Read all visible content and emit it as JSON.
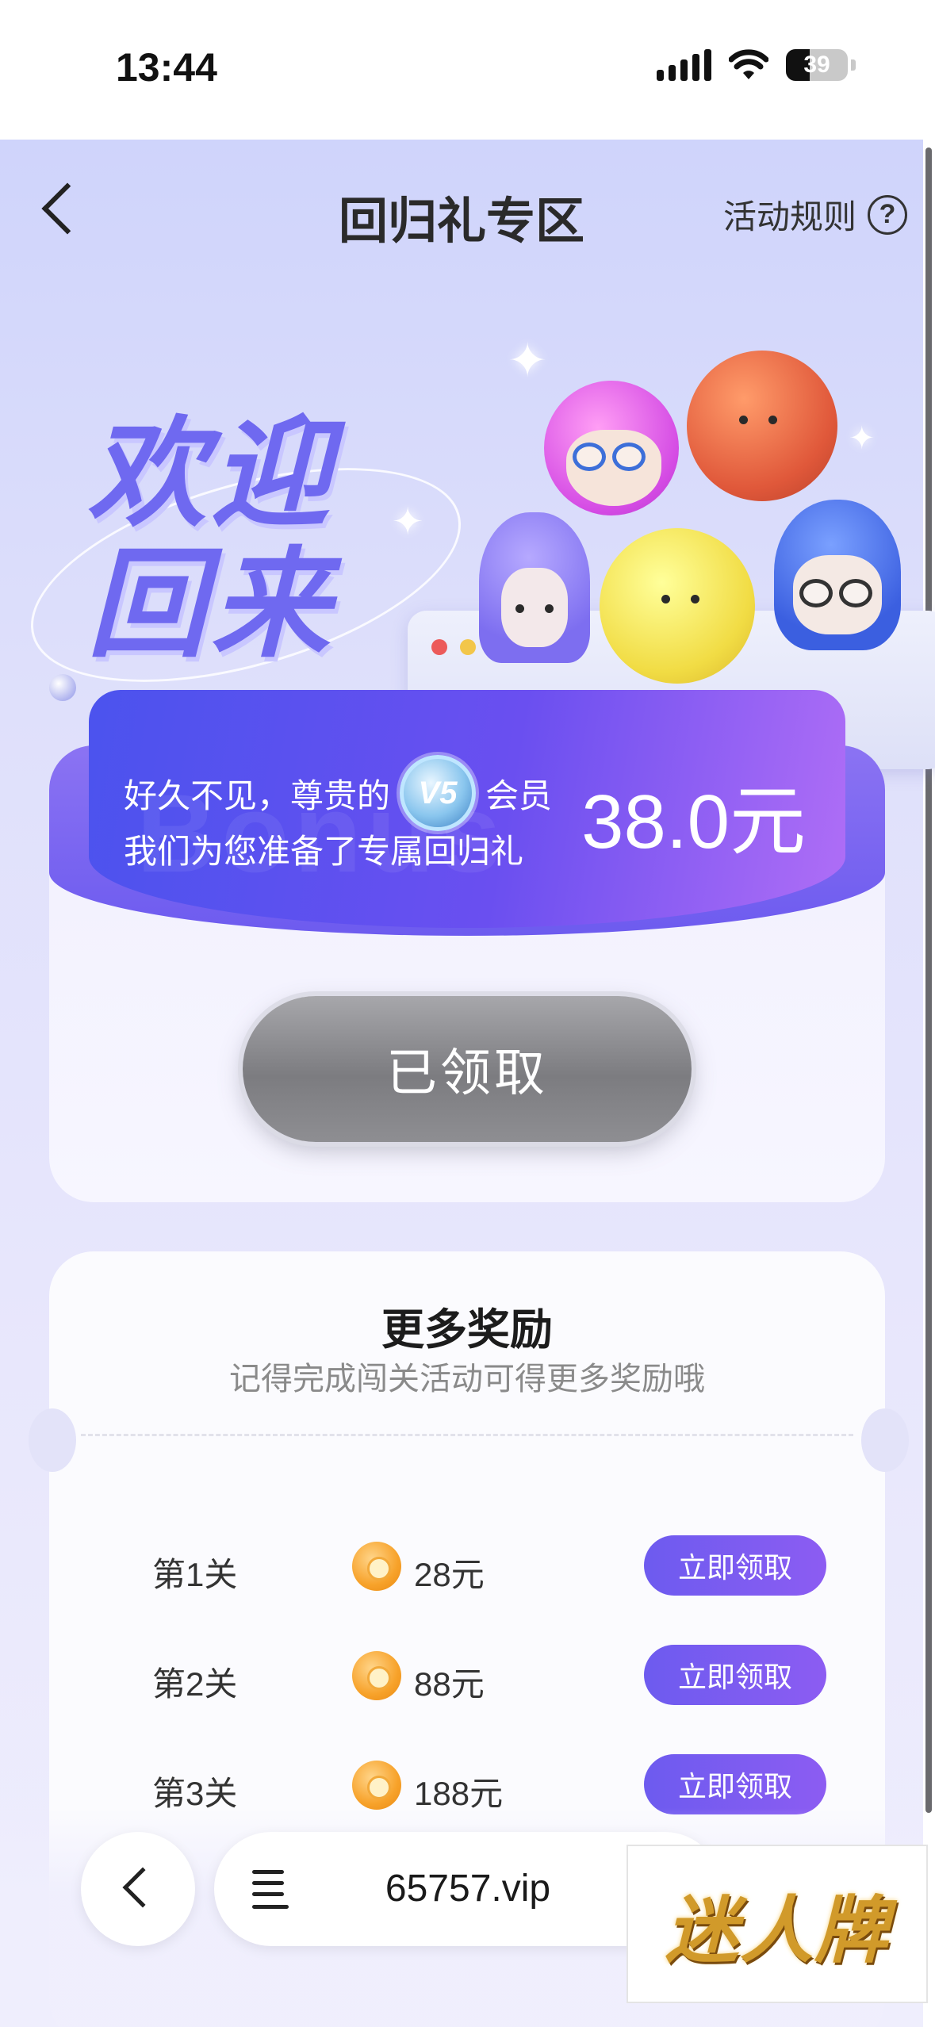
{
  "status_bar": {
    "time": "13:44",
    "battery": "39"
  },
  "nav": {
    "title": "回归礼专区",
    "rules_label": "活动规则",
    "help_glyph": "?"
  },
  "hero": {
    "welcome_line1": "欢迎",
    "welcome_line2": "回来"
  },
  "banner": {
    "greeting_prefix": "好久不见，尊贵的",
    "vip_level": "V5",
    "greeting_suffix": "会员",
    "subtitle": "我们为您准备了专属回归礼",
    "amount": "38.0元",
    "watermark": "Bonus"
  },
  "claimed_button": "已领取",
  "more_rewards": {
    "title": "更多奖励",
    "subtitle": "记得完成闯关活动可得更多奖励哦",
    "levels": [
      {
        "name": "第1关",
        "amount": "28元",
        "button": "立即领取"
      },
      {
        "name": "第2关",
        "amount": "88元",
        "button": "立即领取"
      },
      {
        "name": "第3关",
        "amount": "188元",
        "button": "立即领取"
      }
    ]
  },
  "browser_bar": {
    "url": "65757.vip"
  },
  "watermark_logo": "迷人牌",
  "colors": {
    "accent_purple": "#6d5bef",
    "banner_blue": "#4b53ee",
    "claimed_gray": "#8e8e92",
    "coin_orange": "#f7a22a"
  }
}
